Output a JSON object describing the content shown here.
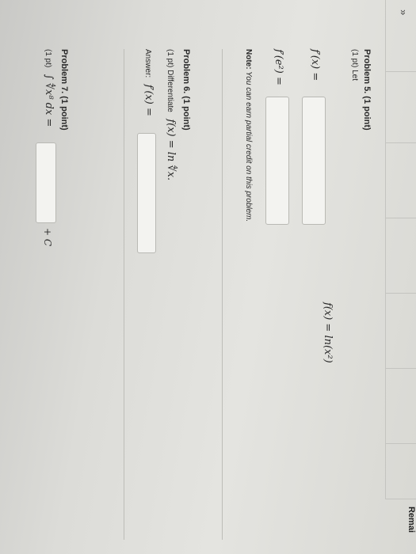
{
  "ui": {
    "remaining_text": "Remai",
    "collapse_icon": "«"
  },
  "problems": {
    "p5": {
      "title": "Problem 5. (1 point)",
      "label": "(1 pt) Let",
      "def": "f(x) = ln(x²)",
      "q1": "f′(x) =",
      "q2": "f′(e²) =",
      "note_prefix": "Note:",
      "note_text": "You can earn partial credit on this problem."
    },
    "p6": {
      "title": "Problem 6. (1 point)",
      "label": "(1 pt) Differentiate",
      "func": "f(x) = ln ∜x.",
      "answer_label": "Answer:",
      "q": "f′(x) ="
    },
    "p7": {
      "title": "Problem 7. (1 point)",
      "label": "(1 pt)",
      "integral": "∫ ∜x⁸ dx =",
      "suffix": "+ C"
    }
  }
}
